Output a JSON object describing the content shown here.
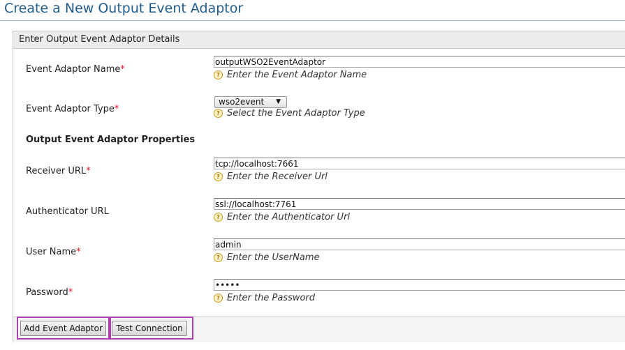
{
  "page": {
    "title": "Create a New Output Event Adaptor"
  },
  "panel": {
    "header": "Enter Output Event Adaptor Details"
  },
  "form": {
    "adaptor_name": {
      "label": "Event Adaptor Name",
      "required": "*",
      "value": "outputWSO2EventAdaptor",
      "hint": "Enter the Event Adaptor Name"
    },
    "adaptor_type": {
      "label": "Event Adaptor Type",
      "required": "*",
      "value": "wso2event",
      "hint": "Select the Event Adaptor Type"
    },
    "properties_title": "Output Event Adaptor Properties",
    "receiver_url": {
      "label": "Receiver URL",
      "required": "*",
      "value": "tcp://localhost:7661",
      "hint": "Enter the Receiver Url"
    },
    "authenticator_url": {
      "label": "Authenticator URL",
      "value": "ssl://localhost:7761",
      "hint": "Enter the Authenticator Url"
    },
    "user_name": {
      "label": "User Name",
      "required": "*",
      "value": "admin",
      "hint": "Enter the UserName"
    },
    "password": {
      "label": "Password",
      "required": "*",
      "value": "admin",
      "hint": "Enter the Password"
    }
  },
  "icons": {
    "hint": "help-icon",
    "dropdown": "chevron-down-icon"
  },
  "buttons": {
    "add": "Add Event Adaptor",
    "test": "Test Connection"
  },
  "colors": {
    "title": "#1f5a8c",
    "required": "#e0161e",
    "highlight": "#b040b0"
  }
}
